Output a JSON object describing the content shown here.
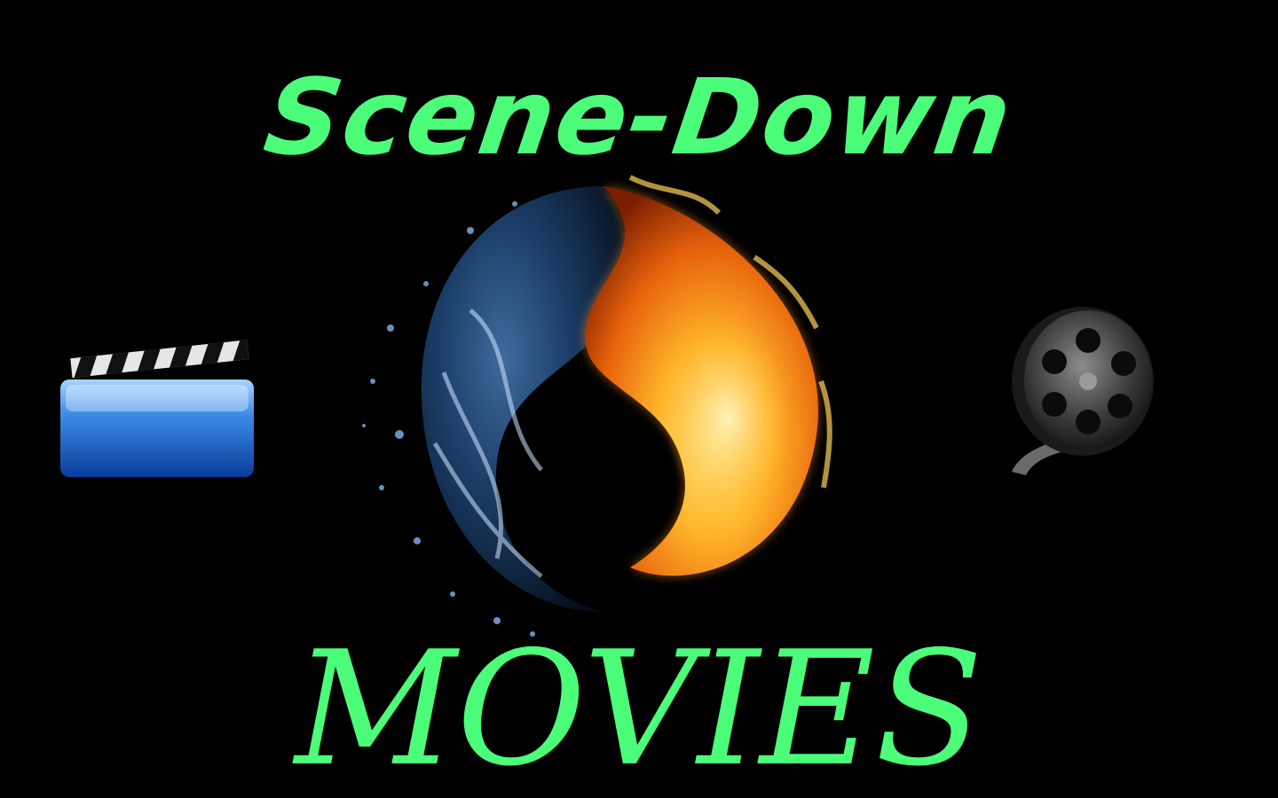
{
  "poster": {
    "title_top": "Scene-Down",
    "title_bottom": "MOVIES"
  },
  "colors": {
    "background": "#000000",
    "title_green": "#4cfd7a",
    "water_blue": "#2f79c8",
    "fire_orange": "#f7a21b"
  },
  "icons": {
    "emblem": "yin-yang-water-fire-icon",
    "left": "clapperboard-icon",
    "right": "film-reel-icon"
  }
}
